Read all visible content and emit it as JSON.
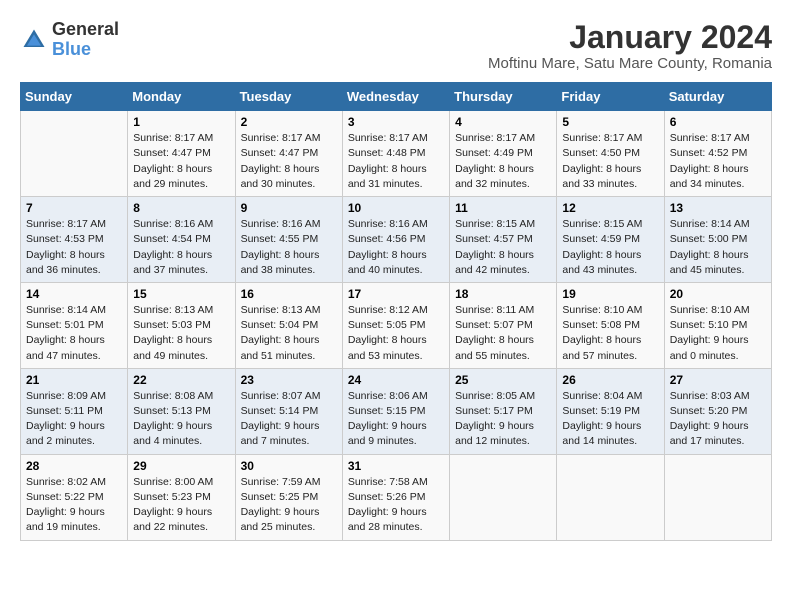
{
  "logo": {
    "general": "General",
    "blue": "Blue"
  },
  "title": "January 2024",
  "subtitle": "Moftinu Mare, Satu Mare County, Romania",
  "days_of_week": [
    "Sunday",
    "Monday",
    "Tuesday",
    "Wednesday",
    "Thursday",
    "Friday",
    "Saturday"
  ],
  "weeks": [
    [
      {
        "day": "",
        "sunrise": "",
        "sunset": "",
        "daylight": ""
      },
      {
        "day": "1",
        "sunrise": "Sunrise: 8:17 AM",
        "sunset": "Sunset: 4:47 PM",
        "daylight": "Daylight: 8 hours and 29 minutes."
      },
      {
        "day": "2",
        "sunrise": "Sunrise: 8:17 AM",
        "sunset": "Sunset: 4:47 PM",
        "daylight": "Daylight: 8 hours and 30 minutes."
      },
      {
        "day": "3",
        "sunrise": "Sunrise: 8:17 AM",
        "sunset": "Sunset: 4:48 PM",
        "daylight": "Daylight: 8 hours and 31 minutes."
      },
      {
        "day": "4",
        "sunrise": "Sunrise: 8:17 AM",
        "sunset": "Sunset: 4:49 PM",
        "daylight": "Daylight: 8 hours and 32 minutes."
      },
      {
        "day": "5",
        "sunrise": "Sunrise: 8:17 AM",
        "sunset": "Sunset: 4:50 PM",
        "daylight": "Daylight: 8 hours and 33 minutes."
      },
      {
        "day": "6",
        "sunrise": "Sunrise: 8:17 AM",
        "sunset": "Sunset: 4:52 PM",
        "daylight": "Daylight: 8 hours and 34 minutes."
      }
    ],
    [
      {
        "day": "7",
        "sunrise": "Sunrise: 8:17 AM",
        "sunset": "Sunset: 4:53 PM",
        "daylight": "Daylight: 8 hours and 36 minutes."
      },
      {
        "day": "8",
        "sunrise": "Sunrise: 8:16 AM",
        "sunset": "Sunset: 4:54 PM",
        "daylight": "Daylight: 8 hours and 37 minutes."
      },
      {
        "day": "9",
        "sunrise": "Sunrise: 8:16 AM",
        "sunset": "Sunset: 4:55 PM",
        "daylight": "Daylight: 8 hours and 38 minutes."
      },
      {
        "day": "10",
        "sunrise": "Sunrise: 8:16 AM",
        "sunset": "Sunset: 4:56 PM",
        "daylight": "Daylight: 8 hours and 40 minutes."
      },
      {
        "day": "11",
        "sunrise": "Sunrise: 8:15 AM",
        "sunset": "Sunset: 4:57 PM",
        "daylight": "Daylight: 8 hours and 42 minutes."
      },
      {
        "day": "12",
        "sunrise": "Sunrise: 8:15 AM",
        "sunset": "Sunset: 4:59 PM",
        "daylight": "Daylight: 8 hours and 43 minutes."
      },
      {
        "day": "13",
        "sunrise": "Sunrise: 8:14 AM",
        "sunset": "Sunset: 5:00 PM",
        "daylight": "Daylight: 8 hours and 45 minutes."
      }
    ],
    [
      {
        "day": "14",
        "sunrise": "Sunrise: 8:14 AM",
        "sunset": "Sunset: 5:01 PM",
        "daylight": "Daylight: 8 hours and 47 minutes."
      },
      {
        "day": "15",
        "sunrise": "Sunrise: 8:13 AM",
        "sunset": "Sunset: 5:03 PM",
        "daylight": "Daylight: 8 hours and 49 minutes."
      },
      {
        "day": "16",
        "sunrise": "Sunrise: 8:13 AM",
        "sunset": "Sunset: 5:04 PM",
        "daylight": "Daylight: 8 hours and 51 minutes."
      },
      {
        "day": "17",
        "sunrise": "Sunrise: 8:12 AM",
        "sunset": "Sunset: 5:05 PM",
        "daylight": "Daylight: 8 hours and 53 minutes."
      },
      {
        "day": "18",
        "sunrise": "Sunrise: 8:11 AM",
        "sunset": "Sunset: 5:07 PM",
        "daylight": "Daylight: 8 hours and 55 minutes."
      },
      {
        "day": "19",
        "sunrise": "Sunrise: 8:10 AM",
        "sunset": "Sunset: 5:08 PM",
        "daylight": "Daylight: 8 hours and 57 minutes."
      },
      {
        "day": "20",
        "sunrise": "Sunrise: 8:10 AM",
        "sunset": "Sunset: 5:10 PM",
        "daylight": "Daylight: 9 hours and 0 minutes."
      }
    ],
    [
      {
        "day": "21",
        "sunrise": "Sunrise: 8:09 AM",
        "sunset": "Sunset: 5:11 PM",
        "daylight": "Daylight: 9 hours and 2 minutes."
      },
      {
        "day": "22",
        "sunrise": "Sunrise: 8:08 AM",
        "sunset": "Sunset: 5:13 PM",
        "daylight": "Daylight: 9 hours and 4 minutes."
      },
      {
        "day": "23",
        "sunrise": "Sunrise: 8:07 AM",
        "sunset": "Sunset: 5:14 PM",
        "daylight": "Daylight: 9 hours and 7 minutes."
      },
      {
        "day": "24",
        "sunrise": "Sunrise: 8:06 AM",
        "sunset": "Sunset: 5:15 PM",
        "daylight": "Daylight: 9 hours and 9 minutes."
      },
      {
        "day": "25",
        "sunrise": "Sunrise: 8:05 AM",
        "sunset": "Sunset: 5:17 PM",
        "daylight": "Daylight: 9 hours and 12 minutes."
      },
      {
        "day": "26",
        "sunrise": "Sunrise: 8:04 AM",
        "sunset": "Sunset: 5:19 PM",
        "daylight": "Daylight: 9 hours and 14 minutes."
      },
      {
        "day": "27",
        "sunrise": "Sunrise: 8:03 AM",
        "sunset": "Sunset: 5:20 PM",
        "daylight": "Daylight: 9 hours and 17 minutes."
      }
    ],
    [
      {
        "day": "28",
        "sunrise": "Sunrise: 8:02 AM",
        "sunset": "Sunset: 5:22 PM",
        "daylight": "Daylight: 9 hours and 19 minutes."
      },
      {
        "day": "29",
        "sunrise": "Sunrise: 8:00 AM",
        "sunset": "Sunset: 5:23 PM",
        "daylight": "Daylight: 9 hours and 22 minutes."
      },
      {
        "day": "30",
        "sunrise": "Sunrise: 7:59 AM",
        "sunset": "Sunset: 5:25 PM",
        "daylight": "Daylight: 9 hours and 25 minutes."
      },
      {
        "day": "31",
        "sunrise": "Sunrise: 7:58 AM",
        "sunset": "Sunset: 5:26 PM",
        "daylight": "Daylight: 9 hours and 28 minutes."
      },
      {
        "day": "",
        "sunrise": "",
        "sunset": "",
        "daylight": ""
      },
      {
        "day": "",
        "sunrise": "",
        "sunset": "",
        "daylight": ""
      },
      {
        "day": "",
        "sunrise": "",
        "sunset": "",
        "daylight": ""
      }
    ]
  ]
}
